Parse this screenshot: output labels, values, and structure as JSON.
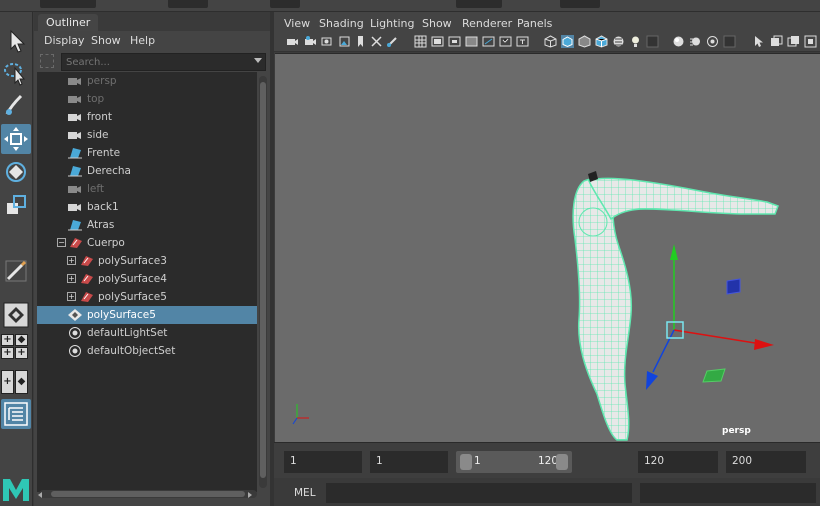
{
  "outliner": {
    "tab_label": "Outliner",
    "menus": [
      "Display",
      "Show",
      "Help"
    ],
    "search_placeholder": "Search...",
    "items": [
      {
        "label": "persp",
        "icon": "camera-icon",
        "dim": true
      },
      {
        "label": "top",
        "icon": "camera-icon",
        "dim": true
      },
      {
        "label": "front",
        "icon": "camera-icon",
        "dim": false
      },
      {
        "label": "side",
        "icon": "camera-icon",
        "dim": false
      },
      {
        "label": "Frente",
        "icon": "image-plane-icon",
        "dim": false
      },
      {
        "label": "Derecha",
        "icon": "image-plane-icon",
        "dim": false
      },
      {
        "label": "left",
        "icon": "camera-icon",
        "dim": true
      },
      {
        "label": "back1",
        "icon": "camera-icon",
        "dim": false
      },
      {
        "label": "Atras",
        "icon": "image-plane-icon",
        "dim": false
      },
      {
        "label": "Cuerpo",
        "icon": "group-icon",
        "dim": false
      },
      {
        "label": "polySurface3",
        "icon": "mesh-icon",
        "dim": false
      },
      {
        "label": "polySurface4",
        "icon": "mesh-icon",
        "dim": false
      },
      {
        "label": "polySurface5",
        "icon": "mesh-icon",
        "dim": false
      },
      {
        "label": "polySurface5",
        "icon": "object-set-icon",
        "dim": false,
        "selected": true
      },
      {
        "label": "defaultLightSet",
        "icon": "set-icon",
        "dim": false
      },
      {
        "label": "defaultObjectSet",
        "icon": "set-icon",
        "dim": false
      }
    ]
  },
  "panel": {
    "menus": [
      "View",
      "Shading",
      "Lighting",
      "Show",
      "Renderer",
      "Panels"
    ],
    "camera_label": "persp"
  },
  "timeslider": {
    "start": "1",
    "playback_start": "1",
    "range_start": "1",
    "range_end": "120",
    "playback_end": "120",
    "end": "200"
  },
  "mel": {
    "label": "MEL"
  },
  "colors": {
    "selection": "#5285a6",
    "viewport_bg": "#6b6b6b",
    "wireframe": "#5fe8b0"
  }
}
